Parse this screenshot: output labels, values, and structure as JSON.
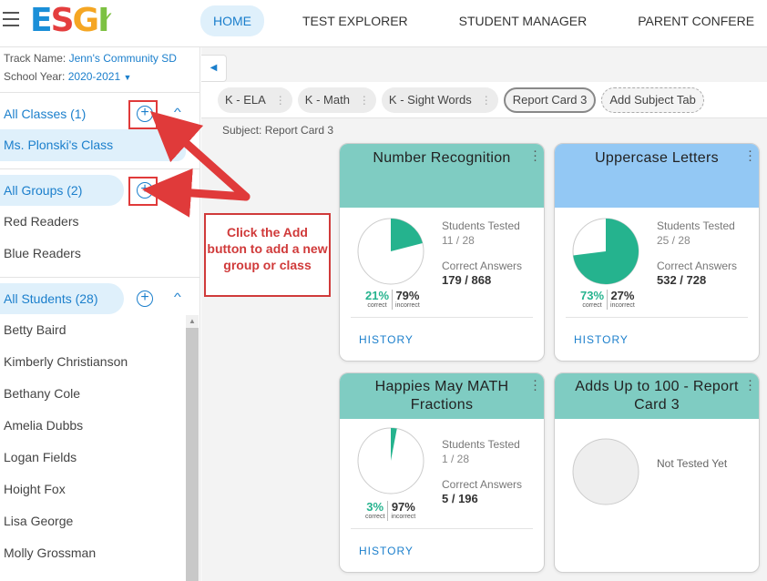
{
  "header": {
    "logo": "ESGI",
    "nav": [
      "HOME",
      "TEST EXPLORER",
      "STUDENT MANAGER",
      "PARENT CONFERE"
    ]
  },
  "sidebar": {
    "track_label": "Track Name:",
    "track_value": "Jenn's Community SD",
    "year_label": "School Year:",
    "year_value": "2020-2021",
    "classes": {
      "label": "All Classes (1)",
      "items": [
        "Ms. Plonski's Class"
      ]
    },
    "groups": {
      "label": "All Groups (2)",
      "items": [
        "Red Readers",
        "Blue Readers"
      ]
    },
    "students": {
      "label": "All Students (28)",
      "items": [
        "Betty Baird",
        "Kimberly Christianson",
        "Bethany Cole",
        "Amelia Dubbs",
        "Logan Fields",
        "Hoight Fox",
        "Lisa George",
        "Molly Grossman"
      ]
    }
  },
  "tabs": [
    "K - ELA",
    "K - Math",
    "K - Sight Words",
    "Report Card 3",
    "Add Subject Tab"
  ],
  "subject": {
    "label": "Subject:",
    "value": "Report Card 3"
  },
  "cards": [
    {
      "title": "Number Recognition",
      "header_color": "#7fccc2",
      "tested_label": "Students Tested",
      "tested": "11 / 28",
      "answers_label": "Correct Answers",
      "answers": "179 / 868",
      "correct_pct": "21%",
      "incorrect_pct": "79%",
      "correct_fraction": 0.21,
      "correct_label": "correct",
      "incorrect_label": "incorrect",
      "history": "HISTORY"
    },
    {
      "title": "Uppercase Letters",
      "header_color": "#93c8f4",
      "tested_label": "Students Tested",
      "tested": "25 / 28",
      "answers_label": "Correct Answers",
      "answers": "532 / 728",
      "correct_pct": "73%",
      "incorrect_pct": "27%",
      "correct_fraction": 0.73,
      "correct_label": "correct",
      "incorrect_label": "incorrect",
      "history": "HISTORY"
    },
    {
      "title": "Happies May MATH Fractions",
      "header_color": "#7fccc2",
      "tested_label": "Students Tested",
      "tested": "1 / 28",
      "answers_label": "Correct Answers",
      "answers": "5 / 196",
      "correct_pct": "3%",
      "incorrect_pct": "97%",
      "correct_fraction": 0.03,
      "correct_label": "correct",
      "incorrect_label": "incorrect",
      "history": "HISTORY"
    },
    {
      "title": "Adds Up to 100 - Report Card 3",
      "header_color": "#7fccc2",
      "status": "Not Tested Yet"
    }
  ],
  "annotation": {
    "text": "Click the Add button to add a new group or class",
    "color": "#e03a3a"
  }
}
